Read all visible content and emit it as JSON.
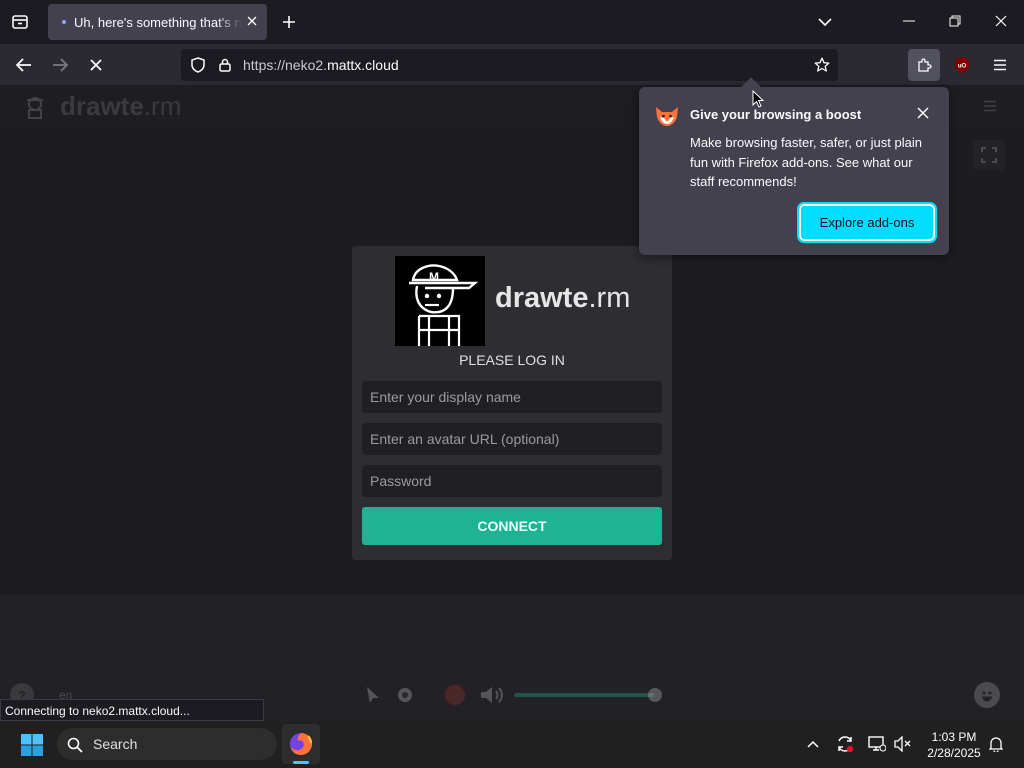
{
  "browser": {
    "tab_title": "Uh, here's something that's new",
    "url_prefix": "https://neko2.",
    "url_domain": "mattx.cloud"
  },
  "app": {
    "logo_bold": "drawte",
    "logo_rest": ".rm",
    "login_title": "PLEASE LOG IN",
    "display_name_placeholder": "Enter your display name",
    "avatar_placeholder": "Enter an avatar URL (optional)",
    "password_placeholder": "Password",
    "connect_label": "CONNECT",
    "lang": "en"
  },
  "popup": {
    "title": "Give your browsing a boost",
    "body": "Make browsing faster, safer, or just plain fun with Firefox add-ons. See what our staff recommends!",
    "button": "Explore add-ons"
  },
  "status_bar": "Connecting to neko2.mattx.cloud...",
  "taskbar": {
    "search_label": "Search",
    "time": "1:03 PM",
    "date": "2/28/2025"
  },
  "colors": {
    "accent": "#1eb395",
    "popup_button": "#00ddff"
  }
}
